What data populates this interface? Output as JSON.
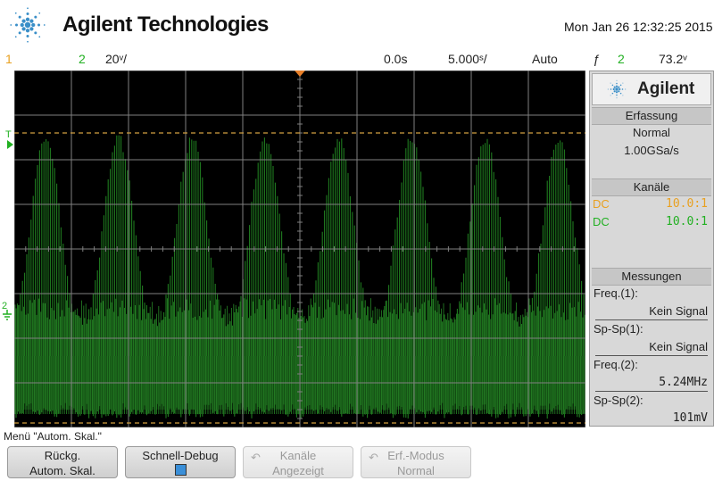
{
  "header": {
    "brand": "Agilent Technologies",
    "datetime": "Mon Jan 26 12:32:25 2015"
  },
  "status": {
    "ch1_label": "1",
    "ch2_label": "2",
    "ch2_scale": "20̵/",
    "scale_display": "20⁰/",
    "delay": "0.0s",
    "timebase": "5.000⁰/",
    "trigger_mode": "Auto",
    "trigger_icon": "trigger-edge-icon",
    "trigger_symbol": "ƒ",
    "trigger_source": "2",
    "trigger_level": "73.2⁰"
  },
  "panel": {
    "logo": "Agilent",
    "acq_header": "Erfassung",
    "acq_mode": "Normal",
    "acq_rate": "1.00GSa/s",
    "ch_header": "Kanäle",
    "ch1_coupling": "DC",
    "ch1_probe": "10.0:1",
    "ch2_coupling": "DC",
    "ch2_probe": "10.0:1",
    "meas_header": "Messungen",
    "m1_label": "Freq.(1):",
    "m1_value": "Kein Signal",
    "m2_label": "Sp-Sp(1):",
    "m2_value": "Kein Signal",
    "m3_label": "Freq.(2):",
    "m3_value": "5.24MHz",
    "m4_label": "Sp-Sp(2):",
    "m4_value": "101mV"
  },
  "menu": {
    "title": "Menü \"Autom. Skal.\"",
    "softkeys": [
      {
        "line1": "Rückg.",
        "line2": "Autom. Skal.",
        "enabled": true
      },
      {
        "line1": "Schnell-Debug",
        "line2": "",
        "enabled": true
      },
      {
        "line1": "Kanäle",
        "line2": "Angezeigt",
        "enabled": false
      },
      {
        "line1": "Erf.-Modus",
        "line2": "Normal",
        "enabled": false
      }
    ]
  },
  "markers": {
    "trigger_marker": "T",
    "ground_marker": "2"
  },
  "colors": {
    "ch1": "#e8a020",
    "ch2": "#22b022",
    "trace": "#1f7a1f",
    "grid": "#808080",
    "cursor": "#d4a040"
  },
  "chart_data": {
    "type": "line",
    "series": [
      {
        "name": "2",
        "envelope_period_div": 1.5,
        "envelope_top_div": 6.6,
        "envelope_bottom_div": 0.2,
        "valley_div": 2.5,
        "cycles": 7
      }
    ],
    "xlim": [
      -25,
      25
    ],
    "ylim": [
      0,
      8
    ],
    "grid": true
  }
}
